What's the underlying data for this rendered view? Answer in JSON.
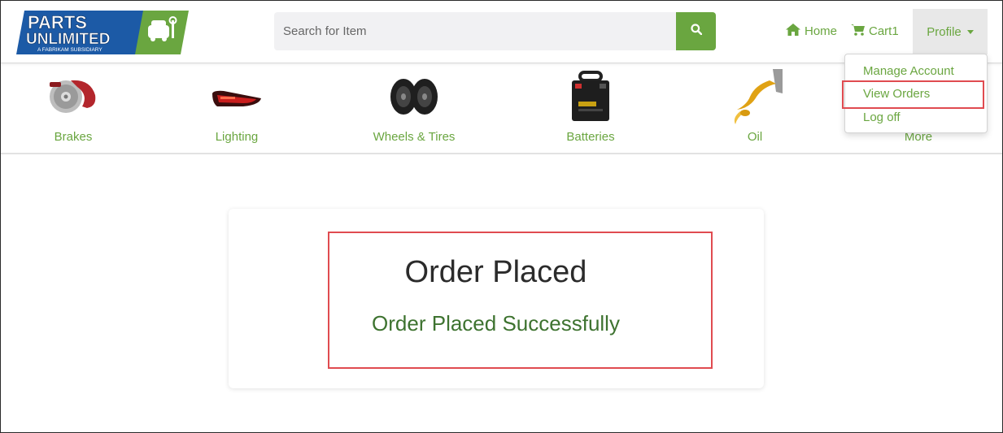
{
  "brand": {
    "line1": "PARTS",
    "line2": "UNLIMITED",
    "tagline": "A FABRIKAM SUBSIDIARY",
    "blue": "#1c5aa6",
    "green": "#6aa640"
  },
  "search": {
    "placeholder": "Search for Item",
    "icon": "search-icon"
  },
  "nav": {
    "home_label": "Home",
    "cart_label": "Cart",
    "cart_count": "1",
    "profile_label": "Profile"
  },
  "categories": [
    {
      "label": "Brakes",
      "icon": "brakes-image"
    },
    {
      "label": "Lighting",
      "icon": "lighting-image"
    },
    {
      "label": "Wheels & Tires",
      "icon": "wheels-tires-image"
    },
    {
      "label": "Batteries",
      "icon": "batteries-image"
    },
    {
      "label": "Oil",
      "icon": "oil-image"
    },
    {
      "label": "More",
      "icon": "more-image"
    }
  ],
  "profile_menu": {
    "items": [
      "Manage Account",
      "View Orders",
      "Log off"
    ],
    "highlighted": "View Orders"
  },
  "order": {
    "title": "Order Placed",
    "message": "Order Placed Successfully"
  },
  "colors": {
    "accent": "#6aa640",
    "highlight_border": "#e04b50",
    "success_text": "#3e7330"
  }
}
